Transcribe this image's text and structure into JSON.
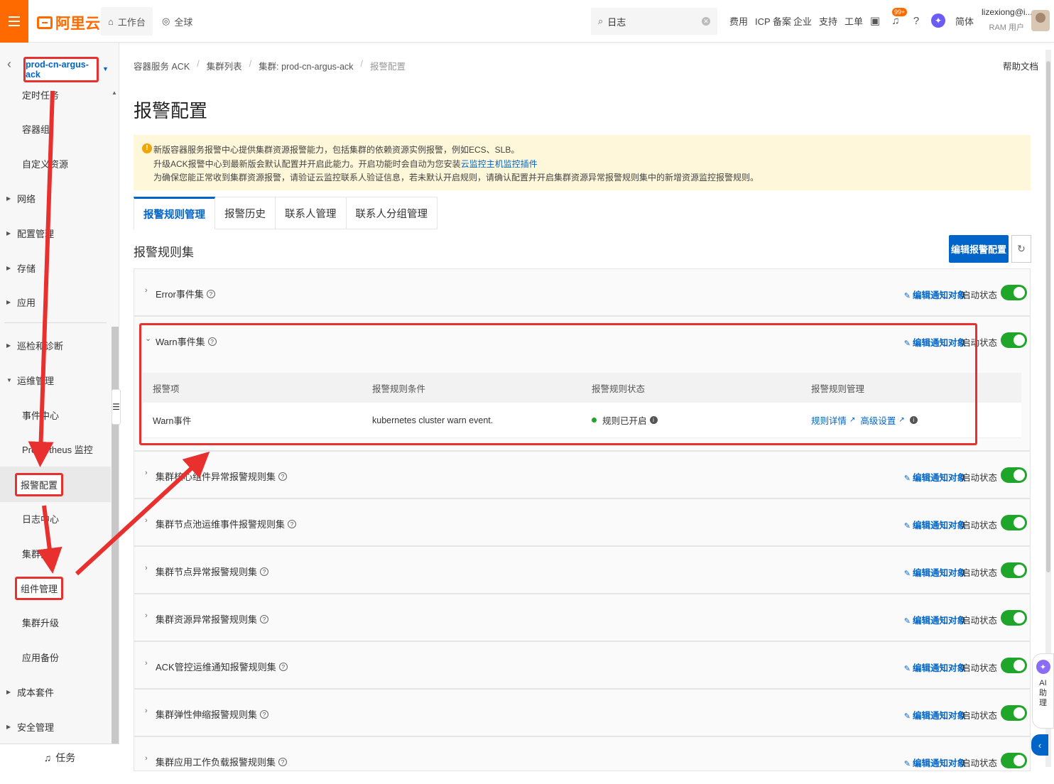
{
  "topbar": {
    "logo_text": "阿里云",
    "workbench_label": "工作台",
    "region_label": "全球",
    "search_value": "日志",
    "links": [
      "费用",
      "ICP 备案",
      "企业",
      "支持",
      "工单"
    ],
    "badge": "99+",
    "lang": "简体",
    "user_name": "lizexiong@i...",
    "user_role": "RAM 用户"
  },
  "sidebar": {
    "cluster_name": "prod-cn-argus-ack",
    "items": [
      {
        "label": "定时任务",
        "type": "child"
      },
      {
        "label": "容器组",
        "type": "child"
      },
      {
        "label": "自定义资源",
        "type": "child"
      },
      {
        "label": "网络",
        "type": "group"
      },
      {
        "label": "配置管理",
        "type": "group"
      },
      {
        "label": "存储",
        "type": "group"
      },
      {
        "label": "应用",
        "type": "group"
      },
      {
        "label": "巡检和诊断",
        "type": "group"
      },
      {
        "label": "运维管理",
        "type": "group-open"
      },
      {
        "label": "事件中心",
        "type": "child"
      },
      {
        "label": "Prometheus 监控",
        "type": "child"
      },
      {
        "label": "报警配置",
        "type": "child-active"
      },
      {
        "label": "日志中心",
        "type": "child"
      },
      {
        "label": "集群拓扑",
        "type": "child"
      },
      {
        "label": "组件管理",
        "type": "child-boxed"
      },
      {
        "label": "集群升级",
        "type": "child"
      },
      {
        "label": "应用备份",
        "type": "child"
      },
      {
        "label": "成本套件",
        "type": "group"
      },
      {
        "label": "安全管理",
        "type": "group"
      }
    ],
    "task_label": "任务"
  },
  "breadcrumb": [
    "容器服务 ACK",
    "集群列表",
    "集群: prod-cn-argus-ack",
    "报警配置"
  ],
  "help_doc": "帮助文档",
  "page_title": "报警配置",
  "notice": {
    "line1": "新版容器服务报警中心提供集群资源报警能力，包括集群的依赖资源实例报警，例如ECS、SLB。",
    "line2_prefix": "升级ACK报警中心到最新版会默认配置并开启此能力。开启功能时会自动为您安装",
    "line2_link": "云监控主机监控插件",
    "line3": "为确保您能正常收到集群资源报警，请验证云监控联系人验证信息，若未默认开启规则，请确认配置并开启集群资源异常报警规则集中的新增资源监控报警规则。"
  },
  "tabs": [
    "报警规则管理",
    "报警历史",
    "联系人管理",
    "联系人分组管理"
  ],
  "ruleset_section_title": "报警规则集",
  "edit_config_button": "编辑报警配置",
  "edit_notify_label": "编辑通知对象",
  "status_label": "启动状态",
  "rulesets": [
    "Error事件集",
    "Warn事件集",
    "集群核心组件异常报警规则集",
    "集群节点池运维事件报警规则集",
    "集群节点异常报警规则集",
    "集群资源异常报警规则集",
    "ACK管控运维通知报警规则集",
    "集群弹性伸缩报警规则集",
    "集群应用工作负载报警规则集"
  ],
  "rule_table": {
    "headers": [
      "报警项",
      "报警规则条件",
      "报警规则状态",
      "报警规则管理"
    ],
    "row": {
      "item": "Warn事件",
      "condition": "kubernetes cluster warn event.",
      "status": "规则已开启",
      "detail_link": "规则详情",
      "advanced_link": "高级设置"
    }
  },
  "ai_assistant": "AI助理",
  "colors": {
    "brand": "#ff6a00",
    "accent": "#0064c8",
    "highlight": "#e8302f",
    "toggle_on": "#1ea52a"
  }
}
